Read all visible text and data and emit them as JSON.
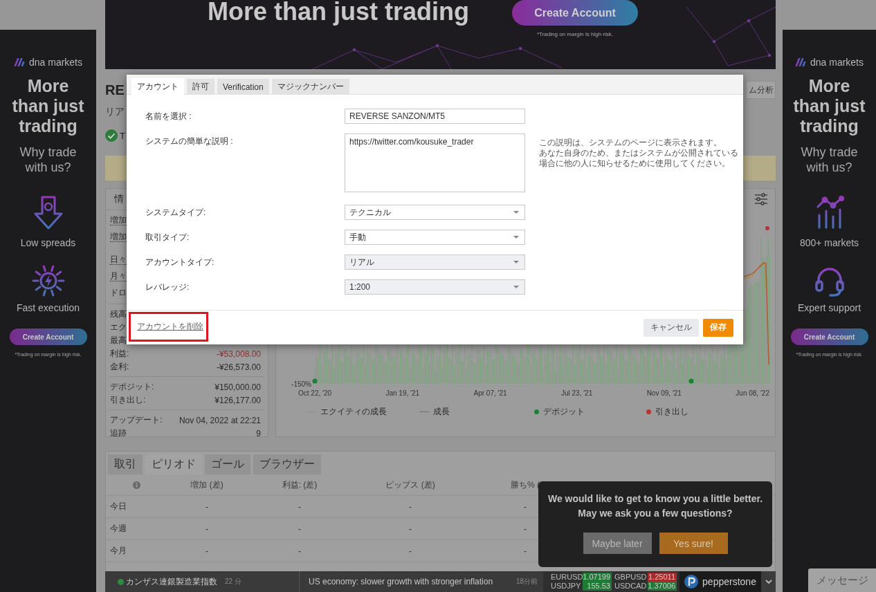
{
  "left_ad": {
    "brand": "dna markets",
    "headline": "More than just trading",
    "subhead": "Why trade with us?",
    "features": [
      {
        "kind": "spreads",
        "label": "Low spreads"
      },
      {
        "kind": "speed",
        "label": "Fast execution"
      }
    ],
    "button": "Create Account",
    "disclaimer": "*Trading on margin is high risk."
  },
  "top_banner": {
    "headline": "More than just trading",
    "button": "Create Account",
    "disclaimer": "*Trading on margin is high risk."
  },
  "right_ad": {
    "brand": "dna markets",
    "headline": "More than just trading",
    "subhead": "Why trade with us?",
    "features": [
      {
        "kind": "markets",
        "label": "800+ markets"
      },
      {
        "kind": "support",
        "label": "Expert support"
      }
    ],
    "button": "Create Account",
    "disclaimer": "*Trading on margin is high risk."
  },
  "system_header": {
    "title": "RE",
    "account_type": "リア",
    "verified": true,
    "status": "T",
    "analysis_button": "ム分析"
  },
  "info_panel": {
    "title": "情",
    "groups": [
      {
        "rows": [
          {
            "label": "増加",
            "dotted": true
          },
          {
            "label": "増加",
            "dotted": true
          },
          {
            "label": "日々",
            "dotted": true
          },
          {
            "label": "月々",
            "dotted": true
          },
          {
            "label": "ドロ",
            "dotted": false
          }
        ]
      },
      {
        "rows": [
          {
            "label": "残高",
            "dotted": false
          },
          {
            "label": "エク",
            "dotted": false
          },
          {
            "label": "最高",
            "dotted": false
          },
          {
            "label": "利益:",
            "dotted": false,
            "value": "-¥53,008.00",
            "loss": true
          },
          {
            "label": "金利:",
            "dotted": false,
            "value": "-¥26,573.00",
            "loss": false
          }
        ]
      },
      {
        "rows": [
          {
            "label": "デポジット:",
            "dotted": false,
            "value": "¥150,000.00",
            "loss": false
          },
          {
            "label": "引き出し:",
            "dotted": false,
            "value": "¥126,177.00",
            "loss": false
          }
        ]
      },
      {
        "rows": [
          {
            "label": "アップデート:",
            "dotted": false,
            "value": "Nov 04, 2022 at 22:21",
            "loss": false
          },
          {
            "label": "追跡",
            "dotted": false,
            "value": "9",
            "loss": false
          }
        ]
      }
    ]
  },
  "chart": {
    "y_ticks": [
      "-150%"
    ],
    "x_ticks": [
      "Oct 22, '20",
      "Jan 19, '21",
      "Apr 07, '21",
      "Jul 23, '21",
      "Nov 09, '21",
      "Jun 08, '22"
    ],
    "legend": [
      {
        "kind": "line",
        "label": "エクイティの成長",
        "color": "#a8923a"
      },
      {
        "kind": "line",
        "label": "成長",
        "color": "#b0583f"
      },
      {
        "kind": "dot",
        "label": "デポジット",
        "color": "#1e7f38"
      },
      {
        "kind": "dot",
        "label": "引き出し",
        "color": "#b23434"
      }
    ]
  },
  "period_panel": {
    "tabs": [
      {
        "label": "取引",
        "selected": false
      },
      {
        "label": "ピリオド",
        "selected": true
      },
      {
        "label": "ゴール",
        "selected": false
      },
      {
        "label": "ブラウザー",
        "selected": false
      }
    ],
    "columns": [
      "増加 (差)",
      "利益: (差)",
      "ピップス (差)",
      "勝ち% ("
    ],
    "rows": [
      {
        "label": "今日",
        "cells": [
          "-",
          "-",
          "-",
          "-"
        ]
      },
      {
        "label": "今週",
        "cells": [
          "-",
          "-",
          "-",
          "-"
        ]
      },
      {
        "label": "今月",
        "cells": [
          "-",
          "-",
          "-",
          "-"
        ]
      }
    ]
  },
  "account_modal": {
    "tabs": [
      {
        "label": "アカウント",
        "selected": true
      },
      {
        "label": "許可",
        "selected": false
      },
      {
        "label": "Verification",
        "selected": false
      },
      {
        "label": "マジックナンバー",
        "selected": false
      }
    ],
    "fields": [
      {
        "kind": "text",
        "label": "名前を選択 :",
        "value": "REVERSE SANZON/MT5",
        "disabled": false
      },
      {
        "kind": "textarea",
        "label": "システムの簡単な説明 :",
        "value": "https://twitter.com/kousuke_trader",
        "disabled": false
      },
      {
        "kind": "select",
        "label": "システムタイプ:",
        "value": "テクニカル",
        "disabled": false
      },
      {
        "kind": "select",
        "label": "取引タイプ:",
        "value": "手動",
        "disabled": false
      },
      {
        "kind": "select",
        "label": "アカウントタイプ:",
        "value": "リアル",
        "disabled": true
      },
      {
        "kind": "select",
        "label": "レバレッジ:",
        "value": "1:200",
        "disabled": true
      }
    ],
    "help_lines": [
      "この説明は、システムのページに表示されます。",
      "あなた自身のため、またはシステムが公開されている",
      "場合に他の人に知らせるために使用してください。"
    ],
    "delete_link": {
      "label": "アカウントを削除",
      "highlighted": true
    },
    "cancel_button": "キャンセル",
    "save_button": "保存"
  },
  "survey": {
    "message": "We would like to get to know you a little better.\nMay we ask you a few questions?",
    "buttons": [
      {
        "kind": "secondary",
        "label": "Maybe later"
      },
      {
        "kind": "primary",
        "label": "Yes sure!"
      }
    ]
  },
  "ticker": {
    "news": [
      {
        "live": true,
        "title": "カンザス連銀製造業指数",
        "age": "22 分"
      },
      {
        "live": false,
        "title": "US economy: slower growth with stronger inflation",
        "age": "18分前"
      }
    ],
    "quotes": [
      {
        "pair": "EURUSD",
        "price": "1.07199",
        "color": "#1f7a35"
      },
      {
        "pair": "GBPUSD",
        "price": "1.25011",
        "color": "#a82a2a"
      },
      {
        "pair": "USDJPY",
        "price": "155.53",
        "color": "#1f7a35"
      },
      {
        "pair": "USDCAD",
        "price": "1.37006",
        "color": "#1f7a35"
      }
    ],
    "sponsor": "pepperstone"
  },
  "message_tab": {
    "label": "メッセージ"
  }
}
